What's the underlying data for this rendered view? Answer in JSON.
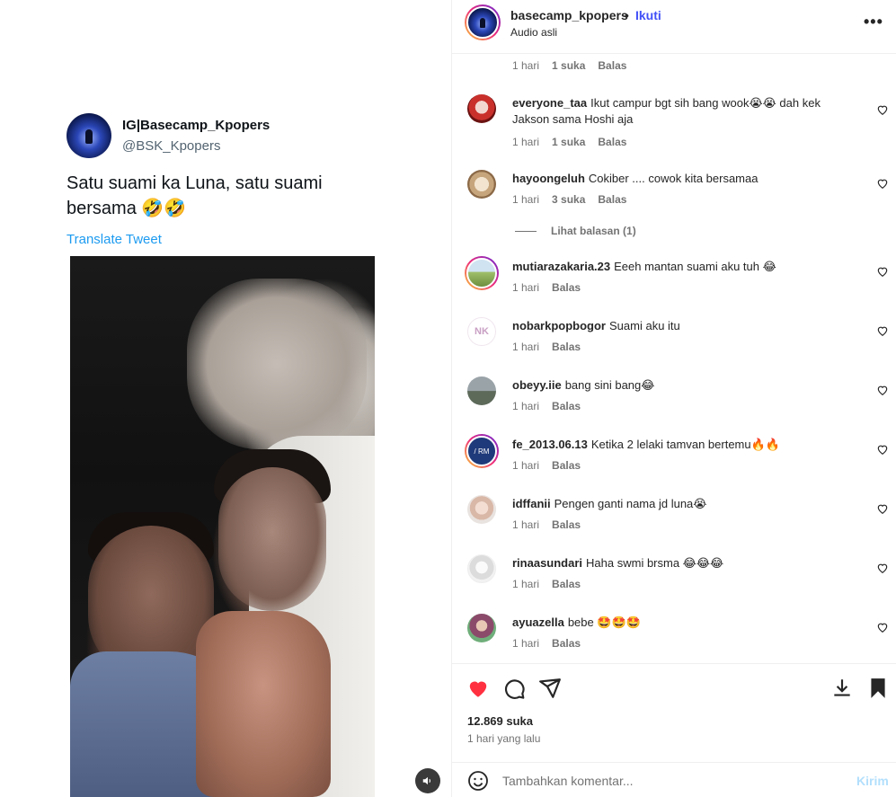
{
  "tweet": {
    "display_name": "IG|Basecamp_Kpopers",
    "handle": "@BSK_Kpopers",
    "text": "Satu suami ka Luna, satu suami bersama 🤣🤣",
    "translate_label": "Translate Tweet"
  },
  "post": {
    "username": "basecamp_kpopers",
    "separator": "•",
    "follow_label": "Ikuti",
    "audio_label": "Audio asli",
    "more_label": "•••"
  },
  "top_meta": {
    "time": "1 hari",
    "likes": "1 suka",
    "reply": "Balas"
  },
  "comments": [
    {
      "user": "everyone_taa",
      "text": "Ikut campur bgt sih bang wook😭😭 dah kek Jakson sama Hoshi aja",
      "time": "1 hari",
      "likes": "1 suka",
      "reply": "Balas"
    },
    {
      "user": "hayoongeluh",
      "text": "Cokiber .... cowok kita bersamaa",
      "time": "1 hari",
      "likes": "3 suka",
      "reply": "Balas"
    },
    {
      "user": "mutiarazakaria.23",
      "text": "Eeeh mantan suami aku tuh 😂",
      "time": "1 hari",
      "likes": "",
      "reply": "Balas"
    },
    {
      "user": "nobarkpopbogor",
      "text": "Suami aku itu",
      "time": "1 hari",
      "likes": "",
      "reply": "Balas"
    },
    {
      "user": "obeyy.iie",
      "text": "bang sini bang😂",
      "time": "1 hari",
      "likes": "",
      "reply": "Balas"
    },
    {
      "user": "fe_2013.06.13",
      "text": "Ketika 2 lelaki tamvan bertemu🔥🔥",
      "time": "1 hari",
      "likes": "",
      "reply": "Balas"
    },
    {
      "user": "idffanii",
      "text": "Pengen ganti nama jd luna😭",
      "time": "1 hari",
      "likes": "",
      "reply": "Balas"
    },
    {
      "user": "rinaasundari",
      "text": "Haha swmi brsma 😂😂😂",
      "time": "1 hari",
      "likes": "",
      "reply": "Balas"
    },
    {
      "user": "ayuazella",
      "text": "bebe 🤩🤩🤩",
      "time": "1 hari",
      "likes": "",
      "reply": "Balas"
    }
  ],
  "view_replies_label": "Lihat balasan (1)",
  "likes_count": "12.869 suka",
  "posted_time": "1 hari yang lalu",
  "add_comment": {
    "placeholder": "Tambahkan komentar...",
    "post_label": "Kirim"
  },
  "colors": {
    "like_red": "#ff3040",
    "follow_blue": "#4150f7",
    "link_blue": "#1d9bf0"
  },
  "icons": [
    "heart-icon",
    "comment-icon",
    "share-icon",
    "download-icon",
    "bookmark-icon",
    "emoji-icon",
    "sound-icon",
    "more-icon"
  ]
}
